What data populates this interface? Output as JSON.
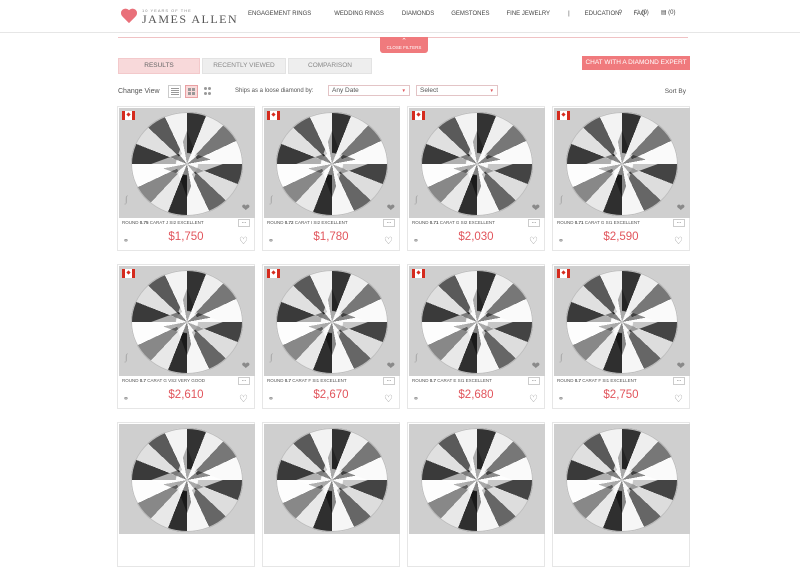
{
  "header": {
    "logo_small": "10 YEARS OF THE",
    "logo_big": "JAMES ALLEN",
    "nav": [
      "ENGAGEMENT RINGS",
      "WEDDING RINGS",
      "DIAMONDS",
      "GEMSTONES",
      "FINE JEWELRY",
      "|",
      "EDUCATION",
      "FAQ"
    ],
    "wishlist_count": "(0)",
    "cart_count": "(0)"
  },
  "filters": {
    "close_label": "CLOSE FILTERS"
  },
  "tabs": [
    "RESULTS",
    "RECENTLY VIEWED",
    "COMPARISON"
  ],
  "chat_button": "CHAT WITH A DIAMOND EXPERT",
  "toolbar": {
    "change_view": "Change View",
    "ships_label": "Ships as a loose diamond by:",
    "date_select": "Any Date",
    "second_select": "Select",
    "sort_label": "Sort By"
  },
  "products": [
    {
      "desc_shape": "ROUND",
      "carat": "0.75",
      "desc_rest": "CARAT J SI2  EXCELLENT",
      "price": "$1,750"
    },
    {
      "desc_shape": "ROUND",
      "carat": "0.72",
      "desc_rest": "CARAT I SI2  EXCELLENT",
      "price": "$1,780"
    },
    {
      "desc_shape": "ROUND",
      "carat": "0.71",
      "desc_rest": "CARAT G SI2  EXCELLENT",
      "price": "$2,030"
    },
    {
      "desc_shape": "ROUND",
      "carat": "0.71",
      "desc_rest": "CARAT G SI1  EXCELLENT",
      "price": "$2,590"
    },
    {
      "desc_shape": "ROUND",
      "carat": "0.7",
      "desc_rest": "CARAT G VS2  VERY GOOD",
      "price": "$2,610"
    },
    {
      "desc_shape": "ROUND",
      "carat": "0.7",
      "desc_rest": "CARAT F SI1  EXCELLENT",
      "price": "$2,670"
    },
    {
      "desc_shape": "ROUND",
      "carat": "0.7",
      "desc_rest": "CARAT E SI1  EXCELLENT",
      "price": "$2,680"
    },
    {
      "desc_shape": "ROUND",
      "carat": "0.7",
      "desc_rest": "CARAT F SI1  EXCELLENT",
      "price": "$2,750"
    }
  ],
  "colors": {
    "accent": "#f07a7d",
    "price": "#e1555c",
    "flag_red": "#d52b1e"
  },
  "icons": [
    "heart-icon",
    "search-icon",
    "cart-icon",
    "list-view-icon",
    "grid-view-icon",
    "large-grid-icon",
    "ring-icon",
    "canada-flag-icon",
    "watermark-logo"
  ]
}
